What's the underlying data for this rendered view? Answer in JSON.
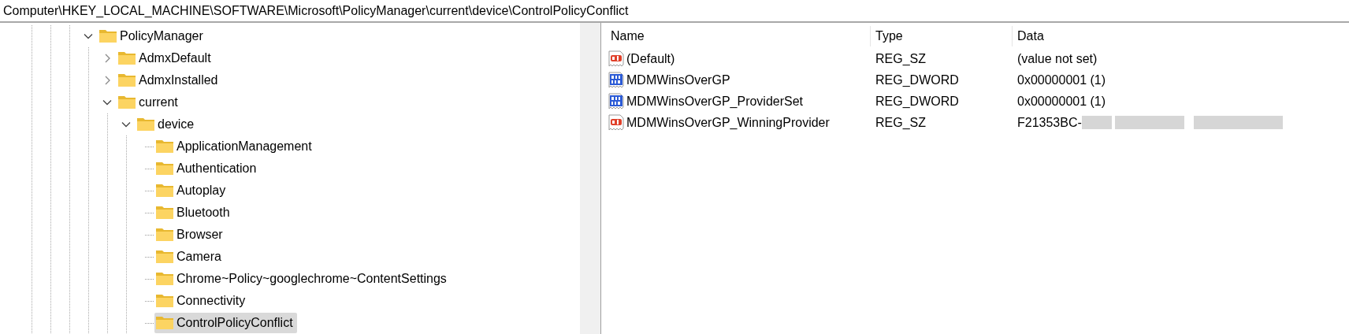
{
  "address_bar": {
    "path": "Computer\\HKEY_LOCAL_MACHINE\\SOFTWARE\\Microsoft\\PolicyManager\\current\\device\\ControlPolicyConflict"
  },
  "tree": {
    "items": [
      {
        "label": "PolicyManager",
        "expanded": true,
        "selected": false,
        "children": [
          {
            "label": "AdmxDefault",
            "expanded": false,
            "selected": false,
            "has_children": true
          },
          {
            "label": "AdmxInstalled",
            "expanded": false,
            "selected": false,
            "has_children": true
          },
          {
            "label": "current",
            "expanded": true,
            "selected": false,
            "children": [
              {
                "label": "device",
                "expanded": true,
                "selected": false,
                "children": [
                  {
                    "label": "ApplicationManagement",
                    "selected": false
                  },
                  {
                    "label": "Authentication",
                    "selected": false
                  },
                  {
                    "label": "Autoplay",
                    "selected": false
                  },
                  {
                    "label": "Bluetooth",
                    "selected": false
                  },
                  {
                    "label": "Browser",
                    "selected": false
                  },
                  {
                    "label": "Camera",
                    "selected": false
                  },
                  {
                    "label": "Chrome~Policy~googlechrome~ContentSettings",
                    "selected": false
                  },
                  {
                    "label": "Connectivity",
                    "selected": false
                  },
                  {
                    "label": "ControlPolicyConflict",
                    "selected": true
                  }
                ]
              }
            ]
          }
        ]
      }
    ]
  },
  "values": {
    "columns": [
      "Name",
      "Type",
      "Data"
    ],
    "rows": [
      {
        "kind": "string",
        "name": "(Default)",
        "type": "REG_SZ",
        "data": "(value not set)"
      },
      {
        "kind": "binary",
        "name": "MDMWinsOverGP",
        "type": "REG_DWORD",
        "data": "0x00000001 (1)"
      },
      {
        "kind": "binary",
        "name": "MDMWinsOverGP_ProviderSet",
        "type": "REG_DWORD",
        "data": "0x00000001 (1)"
      },
      {
        "kind": "string",
        "name": "MDMWinsOverGP_WinningProvider",
        "type": "REG_SZ",
        "data": "F21353BC-",
        "redacted": true
      }
    ]
  }
}
